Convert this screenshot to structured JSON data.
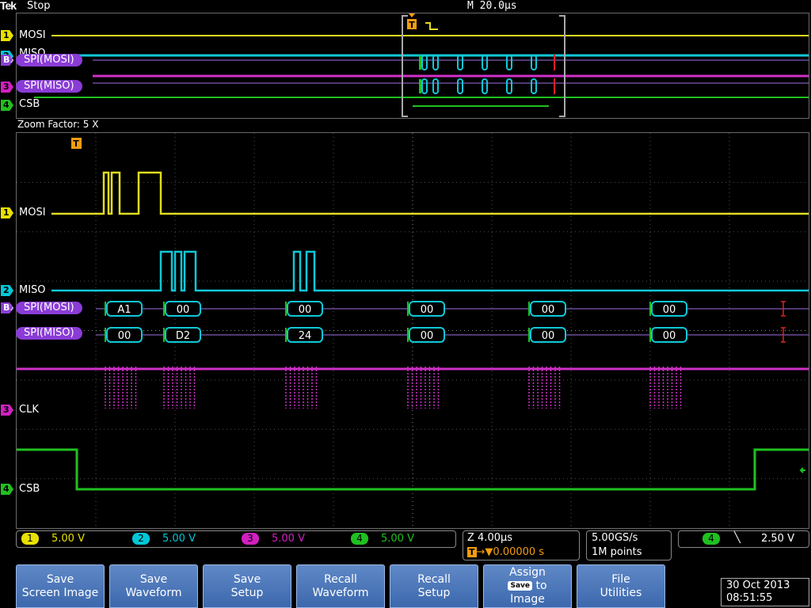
{
  "header": {
    "brand": "Tek",
    "run_state": "Stop",
    "horizontal_scale": "M 20.0µs"
  },
  "overview": {
    "channels": [
      {
        "marker": "1",
        "name": "MOSI",
        "color": "#e8e000"
      },
      {
        "marker": "2",
        "name": "MISO",
        "color": "#00c8d8"
      },
      {
        "marker": "B1",
        "name": "SPI(MOSI)",
        "color": "#8a3cd6"
      },
      {
        "marker": "3",
        "name": "SPI(MISO)",
        "color": "#d020c0"
      },
      {
        "marker": "4",
        "name": "CSB",
        "color": "#20c020"
      }
    ],
    "trigger_marker": "T"
  },
  "zoom": {
    "label": "Zoom Factor: 5 X",
    "trigger_marker": "T",
    "channels": {
      "mosi": {
        "marker": "1",
        "name": "MOSI"
      },
      "miso": {
        "marker": "2",
        "name": "MISO"
      },
      "bus_mosi": {
        "marker": "B1",
        "name": "SPI(MOSI)"
      },
      "bus_miso": {
        "name": "SPI(MISO)"
      },
      "clk": {
        "marker": "3",
        "name": "CLK"
      },
      "csb": {
        "marker": "4",
        "name": "CSB"
      }
    },
    "mosi_bytes": [
      "A1",
      "00",
      "00",
      "00",
      "00",
      "00"
    ],
    "miso_bytes": [
      "00",
      "D2",
      "24",
      "00",
      "00",
      "00"
    ]
  },
  "readouts": {
    "channels": [
      {
        "num": "1",
        "value": "5.00 V",
        "color": "#e8e000"
      },
      {
        "num": "2",
        "value": "5.00 V",
        "color": "#00c8d8"
      },
      {
        "num": "3",
        "value": "5.00 V",
        "color": "#d020c0"
      },
      {
        "num": "4",
        "value": "5.00 V",
        "color": "#20c020"
      }
    ],
    "zoom_time": "Z 4.00µs",
    "trigger_position": "▼0.00000 s",
    "sample_rate": "5.00GS/s",
    "record_length": "1M points",
    "trigger_source": "4",
    "trigger_slope": "╲",
    "trigger_level": "2.50 V"
  },
  "softkeys": [
    {
      "line1": "Save",
      "line2": "Screen Image"
    },
    {
      "line1": "Save",
      "line2": "Waveform"
    },
    {
      "line1": "Save",
      "line2": "Setup"
    },
    {
      "line1": "Recall",
      "line2": "Waveform"
    },
    {
      "line1": "Recall",
      "line2": "Setup"
    },
    {
      "line1": "Assign",
      "chip": "Save",
      "line2": "to",
      "line3": "Image"
    },
    {
      "line1": "File",
      "line2": "Utilities"
    }
  ],
  "datetime": {
    "date": "30 Oct  2013",
    "time": "08:51:55"
  }
}
